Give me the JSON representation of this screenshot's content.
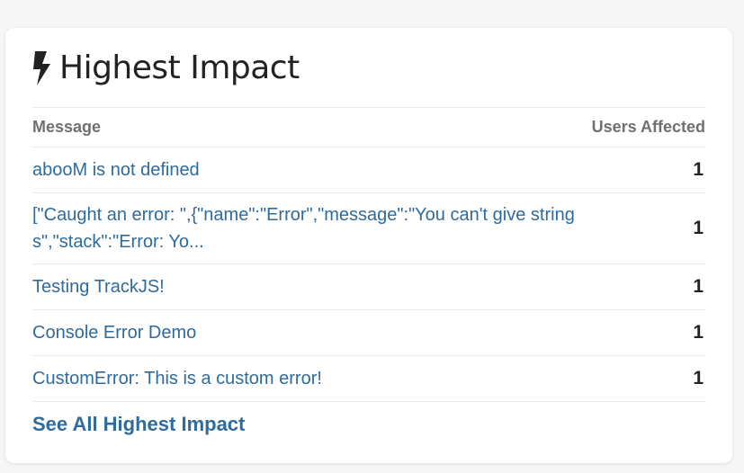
{
  "panel": {
    "icon": "lightning-bolt-icon",
    "title": "Highest Impact"
  },
  "table": {
    "headers": {
      "message": "Message",
      "users": "Users Affected"
    },
    "rows": [
      {
        "message": "abooM is not defined",
        "users": "1"
      },
      {
        "message": "[\"Caught an error: \",{\"name\":\"Error\",\"message\":\"You can't give strings\",\"stack\":\"Error: Yo...",
        "users": "1"
      },
      {
        "message": "Testing TrackJS!",
        "users": "1"
      },
      {
        "message": "Console Error Demo",
        "users": "1"
      },
      {
        "message": "CustomError: This is a custom error!",
        "users": "1"
      }
    ]
  },
  "footer": {
    "link_label": "See All Highest Impact"
  },
  "colors": {
    "link": "#2f6b9c",
    "header_text": "#707070",
    "title_text": "#222222"
  }
}
